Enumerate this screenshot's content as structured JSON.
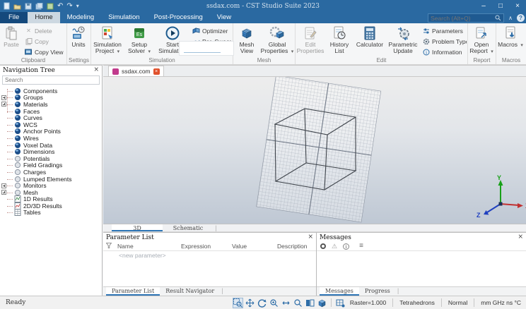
{
  "window": {
    "title": "ssdax.com - CST Studio Suite 2023"
  },
  "icons": {
    "dropdown": "▾",
    "close": "×",
    "collapse_ribbon": "∧",
    "help": "?",
    "minimize": "–",
    "maximize": "□",
    "close_window": "×",
    "undo": "↶",
    "redo": "↷",
    "qat_more": "▾",
    "tab_divider": "|",
    "warning": "⚠",
    "info": "i",
    "list": "≡",
    "delete_x": "✕"
  },
  "colors": {
    "titlebar": "#2a69a1",
    "doc_icon": "#c13a8c",
    "close_button": "#e0512c",
    "axis_x": "#c03030",
    "axis_y": "#18a018",
    "axis_z": "#2040c0"
  },
  "search": {
    "placeholder": "Search (Alt+Q)"
  },
  "ribbon": {
    "tabs": [
      "File",
      "Home",
      "Modeling",
      "Simulation",
      "Post-Processing",
      "View"
    ],
    "active_tab": "Home",
    "groups": [
      {
        "label": "Clipboard",
        "items": [
          "Paste",
          "Delete",
          "Copy",
          "Copy View"
        ]
      },
      {
        "label": "Settings",
        "items": [
          "Units"
        ]
      },
      {
        "label": "Simulation",
        "items": [
          "Simulation Project",
          "Setup Solver",
          "Start Simulation",
          "Optimizer",
          "Par. Sweep"
        ]
      },
      {
        "label": "Mesh",
        "items": [
          "Mesh View",
          "Global Properties"
        ]
      },
      {
        "label": "Edit",
        "items": [
          "Edit Properties",
          "History List",
          "Calculator",
          "Parametric Update",
          "Parameters",
          "Problem Type",
          "Information"
        ]
      },
      {
        "label": "Report",
        "items": [
          "Open Report"
        ]
      },
      {
        "label": "Macros",
        "items": [
          "Macros"
        ]
      }
    ]
  },
  "nav_tree": {
    "title": "Navigation Tree",
    "search_placeholder": "Search",
    "items": [
      {
        "label": "Components"
      },
      {
        "label": "Groups"
      },
      {
        "label": "Materials"
      },
      {
        "label": "Faces"
      },
      {
        "label": "Curves"
      },
      {
        "label": "WCS"
      },
      {
        "label": "Anchor Points"
      },
      {
        "label": "Wires"
      },
      {
        "label": "Voxel Data"
      },
      {
        "label": "Dimensions"
      },
      {
        "label": "Potentials"
      },
      {
        "label": "Field Gradings"
      },
      {
        "label": "Charges"
      },
      {
        "label": "Lumped Elements"
      },
      {
        "label": "Monitors"
      },
      {
        "label": "Mesh"
      },
      {
        "label": "1D Results"
      },
      {
        "label": "2D/3D Results"
      },
      {
        "label": "Tables"
      }
    ]
  },
  "document": {
    "tab_label": "ssdax.com"
  },
  "viewport": {
    "view_tabs": [
      "3D",
      "Schematic"
    ],
    "active_view_tab": "3D",
    "axes": {
      "x": "X",
      "y": "Y",
      "z": "Z"
    }
  },
  "parameter_list": {
    "title": "Parameter List",
    "columns": [
      "Name",
      "Expression",
      "Value",
      "Description"
    ],
    "new_row": "<new parameter>",
    "tabs": [
      "Parameter List",
      "Result Navigator"
    ]
  },
  "messages": {
    "title": "Messages",
    "tabs": [
      "Messages",
      "Progress"
    ]
  },
  "status_bar": {
    "ready": "Ready",
    "raster": "Raster=1.000",
    "mesh_type": "Tetrahedrons",
    "normal": "Normal",
    "units": "mm GHz ns °C"
  }
}
